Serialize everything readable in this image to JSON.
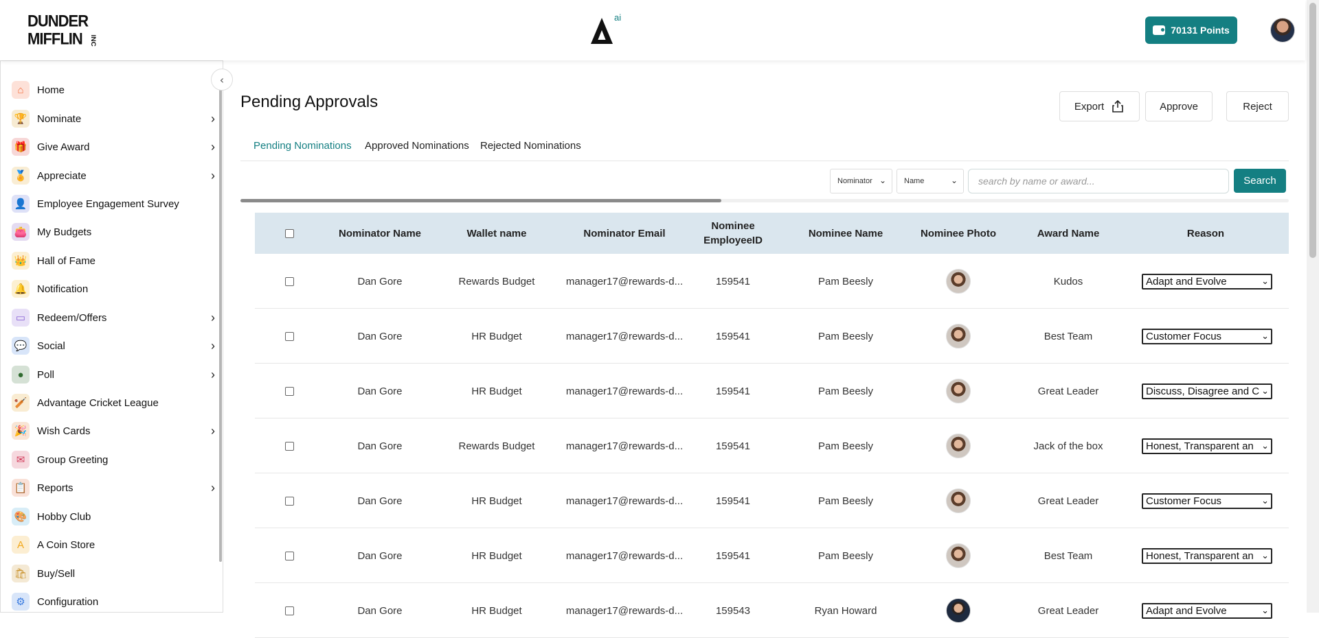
{
  "header": {
    "logo_line1": "DUNDER",
    "logo_line2": "MIFFLIN",
    "logo_inc": "INC",
    "brand_sup": "ai",
    "points_label": "70131  Points"
  },
  "sidebar": {
    "items": [
      {
        "label": "Home",
        "icon": "home-icon",
        "color": "#f46b3b",
        "glyph": "⌂",
        "chev": false
      },
      {
        "label": "Nominate",
        "icon": "trophy-icon",
        "color": "#d99a1e",
        "glyph": "🏆",
        "chev": true
      },
      {
        "label": "Give Award",
        "icon": "gift-icon",
        "color": "#d93636",
        "glyph": "🎁",
        "chev": true
      },
      {
        "label": "Appreciate",
        "icon": "medal-icon",
        "color": "#e0a526",
        "glyph": "🏅",
        "chev": true
      },
      {
        "label": "Employee Engagement Survey",
        "icon": "survey-icon",
        "color": "#5a6bd6",
        "glyph": "👤",
        "chev": false
      },
      {
        "label": "My Budgets",
        "icon": "wallet-icon",
        "color": "#7a4bb8",
        "glyph": "👛",
        "chev": false
      },
      {
        "label": "Hall of Fame",
        "icon": "crown-icon",
        "color": "#f0b020",
        "glyph": "👑",
        "chev": false
      },
      {
        "label": "Notification",
        "icon": "bell-icon",
        "color": "#f2b41c",
        "glyph": "🔔",
        "chev": false
      },
      {
        "label": "Redeem/Offers",
        "icon": "offers-icon",
        "color": "#8a64d6",
        "glyph": "▭",
        "chev": true
      },
      {
        "label": "Social",
        "icon": "social-icon",
        "color": "#3a7be0",
        "glyph": "💬",
        "chev": true
      },
      {
        "label": "Poll",
        "icon": "poll-icon",
        "color": "#2f6b2f",
        "glyph": "●",
        "chev": true
      },
      {
        "label": "Advantage Cricket League",
        "icon": "cricket-icon",
        "color": "#e2a020",
        "glyph": "🏏",
        "chev": false
      },
      {
        "label": "Wish Cards",
        "icon": "party-icon",
        "color": "#e07b2e",
        "glyph": "🎉",
        "chev": true
      },
      {
        "label": "Group Greeting",
        "icon": "envelope-icon",
        "color": "#d23a5a",
        "glyph": "✉",
        "chev": false
      },
      {
        "label": "Reports",
        "icon": "report-icon",
        "color": "#e06a3a",
        "glyph": "📋",
        "chev": true
      },
      {
        "label": "Hobby Club",
        "icon": "hobby-icon",
        "color": "#3aa7d6",
        "glyph": "🎨",
        "chev": false
      },
      {
        "label": "A Coin Store",
        "icon": "coin-icon",
        "color": "#f2a81c",
        "glyph": "A",
        "chev": false
      },
      {
        "label": "Buy/Sell",
        "icon": "shopping-icon",
        "color": "#c9912a",
        "glyph": "🛍",
        "chev": false
      },
      {
        "label": "Configuration",
        "icon": "config-icon",
        "color": "#3a7be0",
        "glyph": "⚙",
        "chev": false
      }
    ]
  },
  "main": {
    "title": "Pending Approvals",
    "actions": {
      "export": "Export",
      "approve": "Approve",
      "reject": "Reject"
    },
    "tabs": [
      "Pending Nominations",
      "Approved Nominations",
      "Rejected Nominations"
    ],
    "filters": {
      "type_selected": "Nominator",
      "field_selected": "Name",
      "search_placeholder": "search by name or award...",
      "search_label": "Search"
    },
    "table": {
      "headers": [
        "Nominator Name",
        "Wallet name",
        "Nominator Email",
        "Nominee EmployeeID",
        "Nominee Name",
        "Nominee Photo",
        "Award Name",
        "Reason"
      ],
      "rows": [
        {
          "nominator": "Dan Gore",
          "wallet": "Rewards Budget",
          "email": "manager17@rewards-d...",
          "emp_id": "159541",
          "nominee": "Pam Beesly",
          "photo": "female",
          "award": "Kudos",
          "reason": "Adapt and Evolve"
        },
        {
          "nominator": "Dan Gore",
          "wallet": "HR Budget",
          "email": "manager17@rewards-d...",
          "emp_id": "159541",
          "nominee": "Pam Beesly",
          "photo": "female",
          "award": "Best Team",
          "reason": "Customer Focus"
        },
        {
          "nominator": "Dan Gore",
          "wallet": "HR Budget",
          "email": "manager17@rewards-d...",
          "emp_id": "159541",
          "nominee": "Pam Beesly",
          "photo": "female",
          "award": "Great Leader",
          "reason": "Discuss, Disagree and C"
        },
        {
          "nominator": "Dan Gore",
          "wallet": "Rewards Budget",
          "email": "manager17@rewards-d...",
          "emp_id": "159541",
          "nominee": "Pam Beesly",
          "photo": "female",
          "award": "Jack of the box",
          "reason": "Honest, Transparent an"
        },
        {
          "nominator": "Dan Gore",
          "wallet": "HR Budget",
          "email": "manager17@rewards-d...",
          "emp_id": "159541",
          "nominee": "Pam Beesly",
          "photo": "female",
          "award": "Great Leader",
          "reason": "Customer Focus"
        },
        {
          "nominator": "Dan Gore",
          "wallet": "HR Budget",
          "email": "manager17@rewards-d...",
          "emp_id": "159541",
          "nominee": "Pam Beesly",
          "photo": "female",
          "award": "Best Team",
          "reason": "Honest, Transparent an"
        },
        {
          "nominator": "Dan Gore",
          "wallet": "HR Budget",
          "email": "manager17@rewards-d...",
          "emp_id": "159543",
          "nominee": "Ryan Howard",
          "photo": "male",
          "award": "Great Leader",
          "reason": "Adapt and Evolve"
        }
      ]
    }
  },
  "colors": {
    "accent": "#147f82",
    "table_header": "#dae6ee"
  }
}
